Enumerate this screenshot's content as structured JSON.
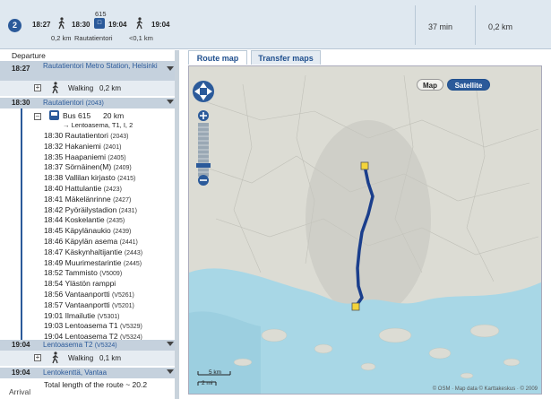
{
  "summary": {
    "route_number": "2",
    "time_depart": "18:27",
    "time_board": "18:30",
    "bus_number": "615",
    "time_alight": "19:04",
    "time_arrive": "19:04",
    "walk_start_distance": "0,2 km",
    "transfer_stop": "Rautatientori",
    "walk_end_distance": "<0,1 km",
    "duration": "37 min",
    "distance": "0,2 km"
  },
  "itinerary": {
    "departure_label": "Departure",
    "start": {
      "time": "18:27",
      "name": "Rautatientori Metro Station, Helsinki"
    },
    "walk1": {
      "label": "Walking",
      "distance": "0,2 km"
    },
    "board": {
      "time": "18:30",
      "name": "Rautatientori",
      "code": "(2043)"
    },
    "bus": {
      "label": "Bus 615",
      "distance": "20 km",
      "direction": "→ Lentoasema, T1, I, 2"
    },
    "stops": [
      {
        "time": "18:30",
        "name": "Rautatientori",
        "code": "(2043)"
      },
      {
        "time": "18:32",
        "name": "Hakaniemi",
        "code": "(2401)"
      },
      {
        "time": "18:35",
        "name": "Haapaniemi",
        "code": "(2405)"
      },
      {
        "time": "18:37",
        "name": "Sörnäinen(M)",
        "code": "(2409)"
      },
      {
        "time": "18:38",
        "name": "Vallilan kirjasto",
        "code": "(2415)"
      },
      {
        "time": "18:40",
        "name": "Hattulantie",
        "code": "(2423)"
      },
      {
        "time": "18:41",
        "name": "Mäkelänrinne",
        "code": "(2427)"
      },
      {
        "time": "18:42",
        "name": "Pyöräilystadion",
        "code": "(2431)"
      },
      {
        "time": "18:44",
        "name": "Koskelantie",
        "code": "(2435)"
      },
      {
        "time": "18:45",
        "name": "Käpylänaukio",
        "code": "(2439)"
      },
      {
        "time": "18:46",
        "name": "Käpylän asema",
        "code": "(2441)"
      },
      {
        "time": "18:47",
        "name": "Käskynhaltijantie",
        "code": "(2443)"
      },
      {
        "time": "18:49",
        "name": "Muurimestarintie",
        "code": "(2445)"
      },
      {
        "time": "18:52",
        "name": "Tammisto",
        "code": "(V5009)"
      },
      {
        "time": "18:54",
        "name": "Ylästön ramppi",
        "code": ""
      },
      {
        "time": "18:56",
        "name": "Vantaanportti",
        "code": "(V5261)"
      },
      {
        "time": "18:57",
        "name": "Vantaanportti",
        "code": "(V5201)"
      },
      {
        "time": "19:01",
        "name": "Ilmailutie",
        "code": "(V5301)"
      },
      {
        "time": "19:03",
        "name": "Lentoasema T1",
        "code": "(V5329)"
      },
      {
        "time": "19:04",
        "name": "Lentoasema T2",
        "code": "(V5324)"
      }
    ],
    "alight": {
      "time": "19:04",
      "name": "Lentoasema T2",
      "code": "(V5324)"
    },
    "walk2": {
      "label": "Walking",
      "distance": "0,1 km"
    },
    "end": {
      "time": "19:04",
      "name": "Lentokenttä, Vantaa"
    },
    "arrival_label": "Arrival",
    "total_length": "Total length of the route ~ 20.2"
  },
  "tabs": {
    "route_map": "Route map",
    "transfer_maps": "Transfer maps"
  },
  "map": {
    "map_button": "Map",
    "satellite_button": "Satellite",
    "scale_km": "5 km",
    "scale_mi": "2 mi",
    "copyright": "© OSM · Map data © Karttakeskus · © 2009"
  },
  "colors": {
    "accent": "#2b5a9a",
    "route_line": "#1a3e8c",
    "water": "#a8d7e6",
    "land": "#dcdcd4"
  }
}
